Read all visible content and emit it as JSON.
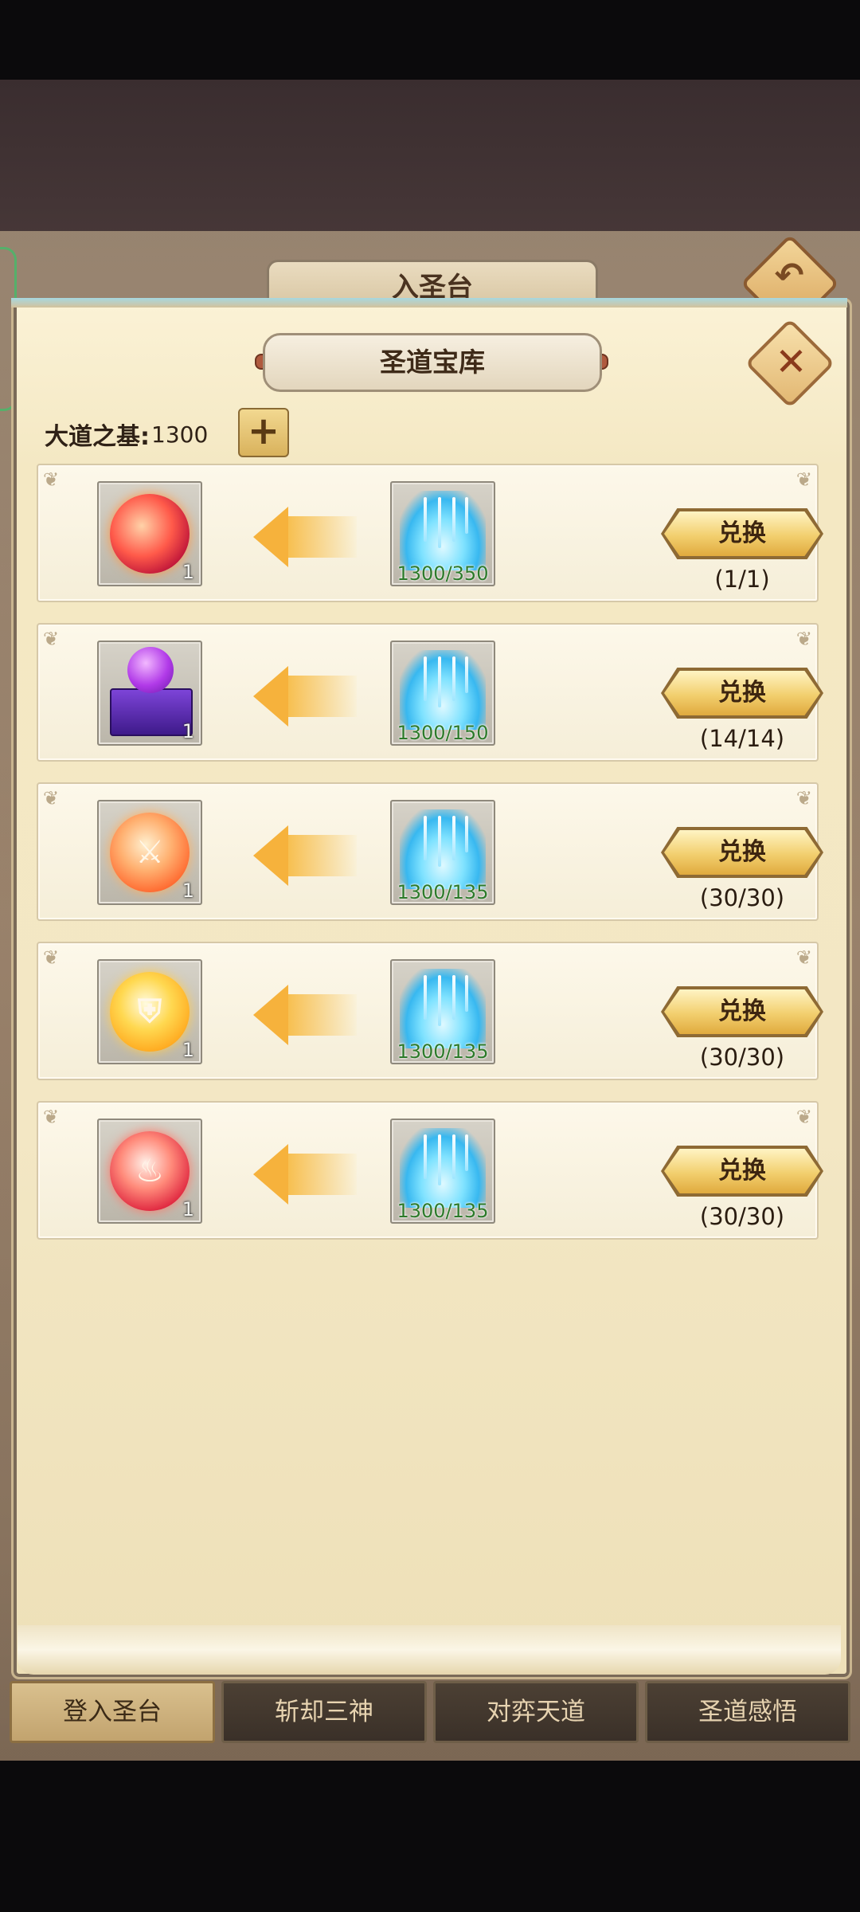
{
  "outer_title": "入圣台",
  "dialog": {
    "title": "圣道宝库",
    "currency_label": "大道之基:",
    "currency_value": "1300",
    "plus_symbol": "+",
    "close_symbol": "✕",
    "back_symbol": "↶"
  },
  "exchange_items": [
    {
      "reward_icon": "red-orb-icon",
      "reward_count": "1",
      "cost_icon": "fountain-icon",
      "cost_text": "1300/350",
      "button_label": "兑换",
      "limit": "(1/1)"
    },
    {
      "reward_icon": "purple-orb-box-icon",
      "reward_count": "1",
      "cost_icon": "fountain-icon",
      "cost_text": "1300/150",
      "button_label": "兑换",
      "limit": "(14/14)"
    },
    {
      "reward_icon": "sword-orb-icon",
      "reward_count": "1",
      "cost_icon": "fountain-icon",
      "cost_text": "1300/135",
      "button_label": "兑换",
      "limit": "(30/30)"
    },
    {
      "reward_icon": "gold-shield-orb-icon",
      "reward_count": "1",
      "cost_icon": "fountain-icon",
      "cost_text": "1300/135",
      "button_label": "兑换",
      "limit": "(30/30)"
    },
    {
      "reward_icon": "fire-orb-icon",
      "reward_count": "1",
      "cost_icon": "fountain-icon",
      "cost_text": "1300/135",
      "button_label": "兑换",
      "limit": "(30/30)"
    }
  ],
  "tabs": [
    {
      "label": "登入圣台",
      "active": true
    },
    {
      "label": "斩却三神",
      "active": false
    },
    {
      "label": "对弈天道",
      "active": false
    },
    {
      "label": "圣道感悟",
      "active": false
    }
  ]
}
